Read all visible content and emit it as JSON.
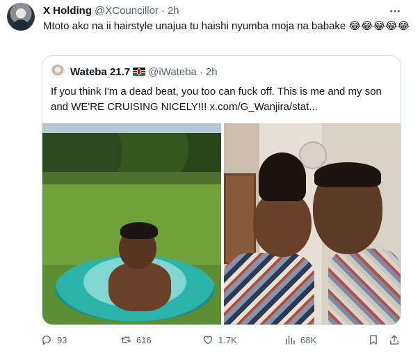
{
  "tweet": {
    "author": {
      "display_name": "X Holding",
      "handle": "@XCouncillor",
      "separator": "·",
      "time": "2h"
    },
    "text": "Mtoto ako na ii hairstyle unajua tu haishi nyumba moja na babake",
    "emojis": "😂😂😂😂😂",
    "more_icon": "ellipsis-icon"
  },
  "quote": {
    "author": {
      "display_name": "Wateba 21.7",
      "flag": "kenya-flag",
      "handle": "@iWateba",
      "separator": "·",
      "time": "2h"
    },
    "text_line1": "If you think I'm a dead beat, you too can fuck off. This is me and my son",
    "text_line2": "and WE'RE CRUISING NICELY!!!",
    "link": "x.com/G_Wanjira/stat..."
  },
  "actions": {
    "reply": {
      "icon": "reply-icon",
      "count": "93"
    },
    "retweet": {
      "icon": "retweet-icon",
      "count": "616"
    },
    "like": {
      "icon": "heart-icon",
      "count": "1.7K"
    },
    "views": {
      "icon": "views-icon",
      "count": "68K"
    },
    "bookmark": {
      "icon": "bookmark-icon"
    },
    "share": {
      "icon": "share-icon"
    }
  },
  "colors": {
    "text_primary": "#0f1419",
    "text_secondary": "#536471",
    "border": "#cfd9de"
  }
}
